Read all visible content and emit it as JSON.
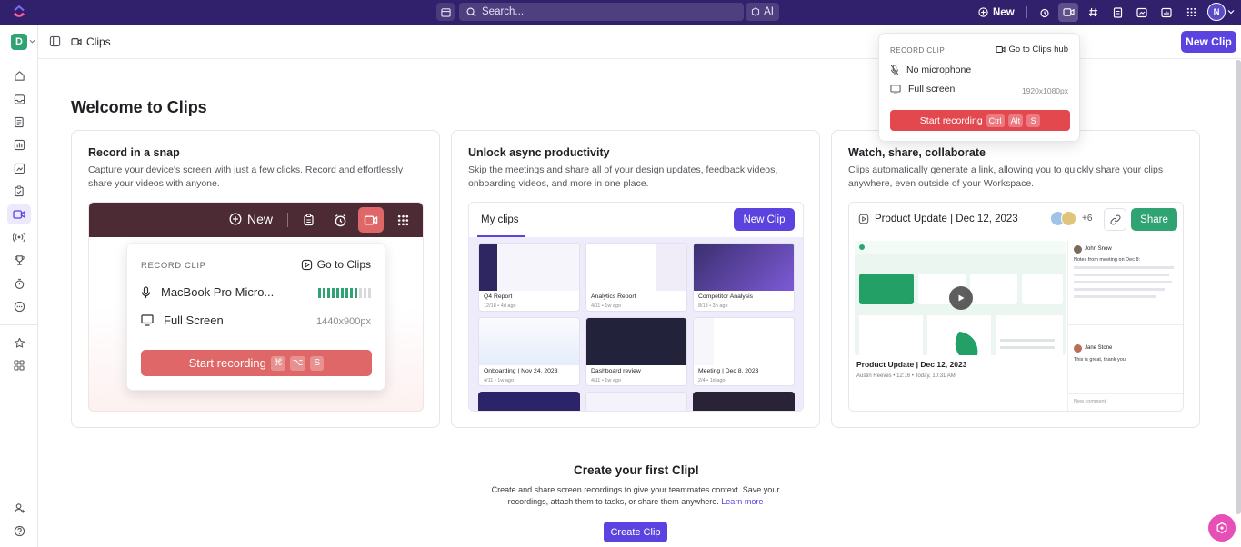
{
  "topbar": {
    "search_placeholder": "Search...",
    "ai_label": "AI",
    "new_label": "New",
    "avatar_initial": "N"
  },
  "sidebar": {
    "workspace_initial": "D"
  },
  "header": {
    "title": "Clips",
    "new_clip_label": "New Clip"
  },
  "record_popover": {
    "label": "RECORD CLIP",
    "hub_link": "Go to Clips hub",
    "microphone": "No microphone",
    "screen": "Full screen",
    "resolution": "1920x1080px",
    "start_label": "Start recording",
    "keys": [
      "Ctrl",
      "Alt",
      "S"
    ]
  },
  "main": {
    "welcome": "Welcome to Clips",
    "cards": [
      {
        "title": "Record in a snap",
        "desc": "Capture your device's screen with just a few clicks. Record and effortlessly share your videos with anyone.",
        "preview": {
          "new_label": "New",
          "pop_label": "RECORD CLIP",
          "pop_link": "Go to Clips",
          "mic": "MacBook Pro Micro...",
          "screen": "Full Screen",
          "resolution": "1440x900px",
          "start_label": "Start recording",
          "keys": [
            "⌘",
            "⌥",
            "S"
          ],
          "meter_level": 0.75
        }
      },
      {
        "title": "Unlock async productivity",
        "desc": "Skip the meetings and share all of your design updates, feedback videos, onboarding videos, and more in one place.",
        "preview": {
          "tab": "My clips",
          "button": "New Clip",
          "clips": [
            {
              "title": "Q4 Report",
              "sub": "12/18 • 4d ago"
            },
            {
              "title": "Analytics Report",
              "sub": "4/11 • 1w ago"
            },
            {
              "title": "Competitor Analysis",
              "sub": "8/13 • 3h ago"
            },
            {
              "title": "Onboarding | Nov 24, 2023",
              "sub": "4/11 • 1w ago"
            },
            {
              "title": "Dashboard review",
              "sub": "4/11 • 1w ago"
            },
            {
              "title": "Meeting | Dec 8, 2023",
              "sub": "2/4 • 1d ago"
            }
          ]
        }
      },
      {
        "title": "Watch, share, collaborate",
        "desc": "Clips automatically generate a link, allowing you to quickly share your clips anywhere, even outside of your Workspace.",
        "preview": {
          "title": "Product Update | Dec 12, 2023",
          "plus": "+6",
          "share": "Share",
          "video_title": "Product Update | Dec 12, 2023",
          "video_sub": "Austin Reeves • 12:16 • Today, 10:31 AM",
          "comment1_name": "John Snow",
          "comment1_text": "Notes from meeting on Dec 8:",
          "comment2_name": "Jane Stone",
          "comment2_text": "This is great, thank you!",
          "comment_placeholder": "New comment"
        }
      }
    ]
  },
  "cta": {
    "title": "Create your first Clip!",
    "desc": "Create and share screen recordings to give your teammates context. Save your recordings, attach them to tasks, or share them anywhere.",
    "learn_more": "Learn more",
    "button": "Create Clip"
  },
  "colors": {
    "topbar": "#31206b",
    "accent": "#5b43e0",
    "record": "#e3484f",
    "green": "#2fa372"
  }
}
